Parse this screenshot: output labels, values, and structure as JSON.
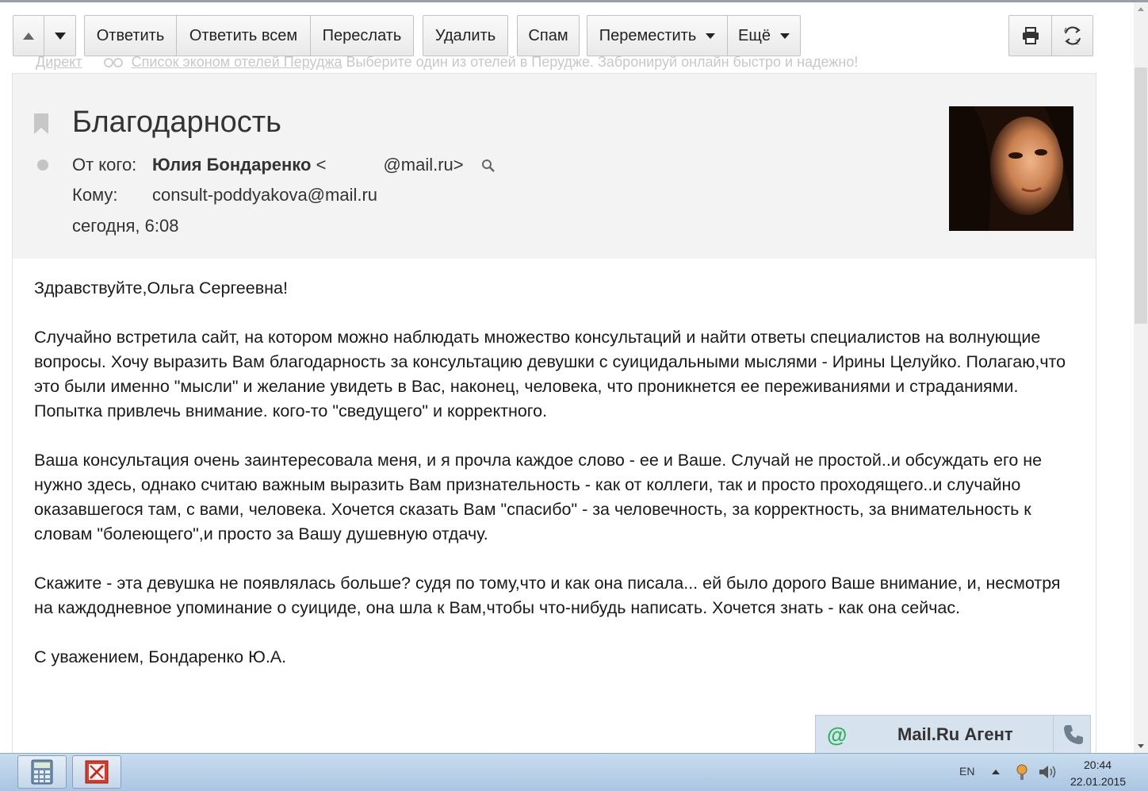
{
  "toolbar": {
    "prev_icon": "arrow-up-icon",
    "next_icon": "arrow-down-icon",
    "reply": "Ответить",
    "reply_all": "Ответить всем",
    "forward": "Переслать",
    "delete": "Удалить",
    "spam": "Спам",
    "move": "Переместить",
    "more": "Ещё",
    "print_icon": "printer-icon",
    "translate_icon": "translate-icon"
  },
  "ad": {
    "label": "Директ",
    "link": "Список эконом отелей Перуджа",
    "text": " Выберите один из отелей в Перудже. Забронируй онлайн быстро и надежно!"
  },
  "message": {
    "subject": "Благодарность",
    "from_label": "От кого:",
    "from_name": "Юлия Бондаренко",
    "from_email_open": "<",
    "from_email_rest": "@mail.ru>",
    "to_label": "Кому:",
    "to": "consult-poddyakova@mail.ru",
    "date": "сегодня, 6:08"
  },
  "body": [
    "Здравствуйте,Ольга Сергеевна!",
    "Случайно встретила сайт, на котором можно наблюдать множество консультаций и найти ответы специалистов на волнующие вопросы. Хочу выразить Вам благодарность за консультацию девушки с суицидальными мыслями - Ирины Целуйко. Полагаю,что это были именно \"мысли\" и желание увидеть в Вас, наконец, человека, что проникнется ее переживаниями и страданиями. Попытка привлечь внимание. кого-то \"сведущего\" и корректного.",
    "Ваша консультация очень заинтересовала меня, и я прочла каждое слово - ее и Ваше. Случай не простой..и обсуждать его не нужно здесь, однако считаю важным выразить Вам признательность - как от коллеги, так и просто проходящего..и случайно оказавшегося там, с вами, человека. Хочется сказать Вам \"спасибо\" - за человечность, за корректность, за внимательность к словам \"болеющего\",и просто за Вашу душевную отдачу.",
    "Скажите - эта девушка не появлялась больше? судя по тому,что и как она писала... ей было дорого Ваше внимание, и, несмотря на каждодневное упоминание о суициде, она шла к Вам,чтобы что-нибудь написать. Хочется знать - как она сейчас.",
    "С уважением, Бондаренко Ю.А."
  ],
  "agent": {
    "icon": "@",
    "title": "Mail.Ru Агент"
  },
  "taskbar": {
    "lang": "EN",
    "time": "20:44",
    "date": "22.01.2015"
  },
  "colors": {
    "header_bg": "#f3f3f3",
    "agent_bg": "#d6e3ef",
    "agent_at": "#2eb25c",
    "taskbar": "#b8d0e8"
  }
}
